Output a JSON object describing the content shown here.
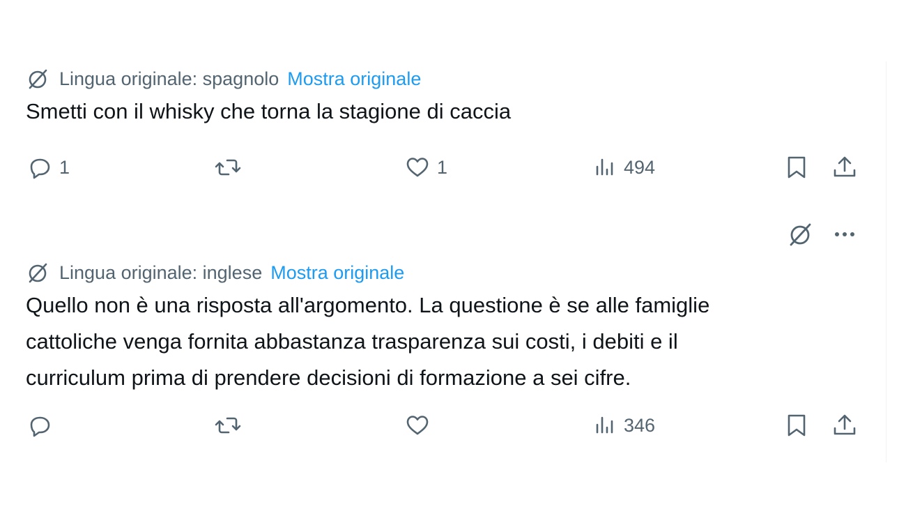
{
  "tweets": [
    {
      "translation": {
        "label": "Lingua originale: spagnolo",
        "link": "Mostra originale"
      },
      "text": "Smetti con il whisky che torna la stagione di caccia",
      "actions": {
        "replies": "1",
        "retweets": "",
        "likes": "1",
        "views": "494"
      }
    },
    {
      "translation": {
        "label": "Lingua originale: inglese",
        "link": "Mostra originale"
      },
      "text": "Quello non è una risposta all'argomento. La questione è se alle famiglie\ncattoliche venga fornita abbastanza trasparenza sui costi, i debiti e il\ncurriculum prima di prendere decisioni di formazione a sei cifre.",
      "actions": {
        "replies": "",
        "retweets": "",
        "likes": "",
        "views": "346"
      }
    }
  ],
  "icons": {
    "translate": "translate-icon",
    "reply": "reply-icon",
    "retweet": "retweet-icon",
    "like": "heart-icon",
    "views": "views-icon",
    "bookmark": "bookmark-icon",
    "share": "share-icon",
    "more": "more-icon"
  },
  "colors": {
    "text": "#0f1419",
    "muted": "#536471",
    "link": "#1d9bf0"
  }
}
